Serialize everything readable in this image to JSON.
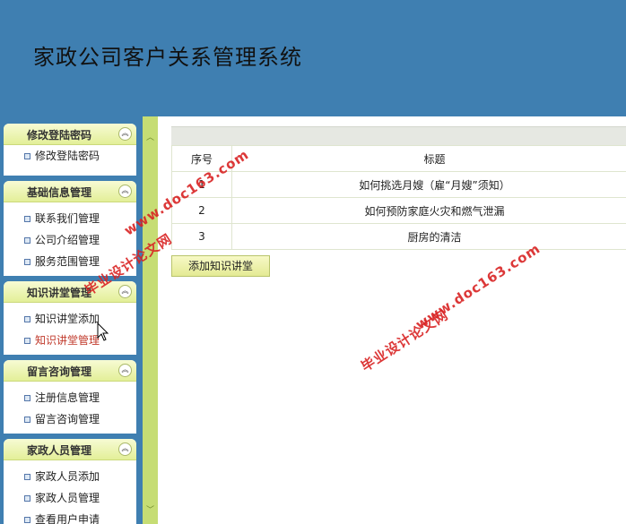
{
  "app": {
    "title": "家政公司客户关系管理系统"
  },
  "sidebar": {
    "groups": [
      {
        "title": "修改登陆密码",
        "items": [
          "修改登陆密码"
        ]
      },
      {
        "title": "基础信息管理",
        "items": [
          "联系我们管理",
          "公司介绍管理",
          "服务范围管理"
        ]
      },
      {
        "title": "知识讲堂管理",
        "items": [
          "知识讲堂添加",
          "知识讲堂管理"
        ]
      },
      {
        "title": "留言咨询管理",
        "items": [
          "注册信息管理",
          "留言咨询管理"
        ]
      },
      {
        "title": "家政人员管理",
        "items": [
          "家政人员添加",
          "家政人员管理",
          "查看用户申请"
        ]
      }
    ],
    "active_item": "知识讲堂管理"
  },
  "table": {
    "headers": [
      "序号",
      "标题"
    ],
    "rows": [
      [
        "1",
        "如何挑选月嫂（雇“月嫂”须知）"
      ],
      [
        "2",
        "如何预防家庭火灾和燃气泄漏"
      ],
      [
        "3",
        "厨房的清洁"
      ]
    ]
  },
  "add_button": "添加知识讲堂",
  "watermarks": {
    "site": "www.doc163.com",
    "name": "毕业设计论文网"
  },
  "colors": {
    "header_bg": "#3f7fb1",
    "accent_green": "#c6dd74",
    "watermark": "#d92323"
  }
}
